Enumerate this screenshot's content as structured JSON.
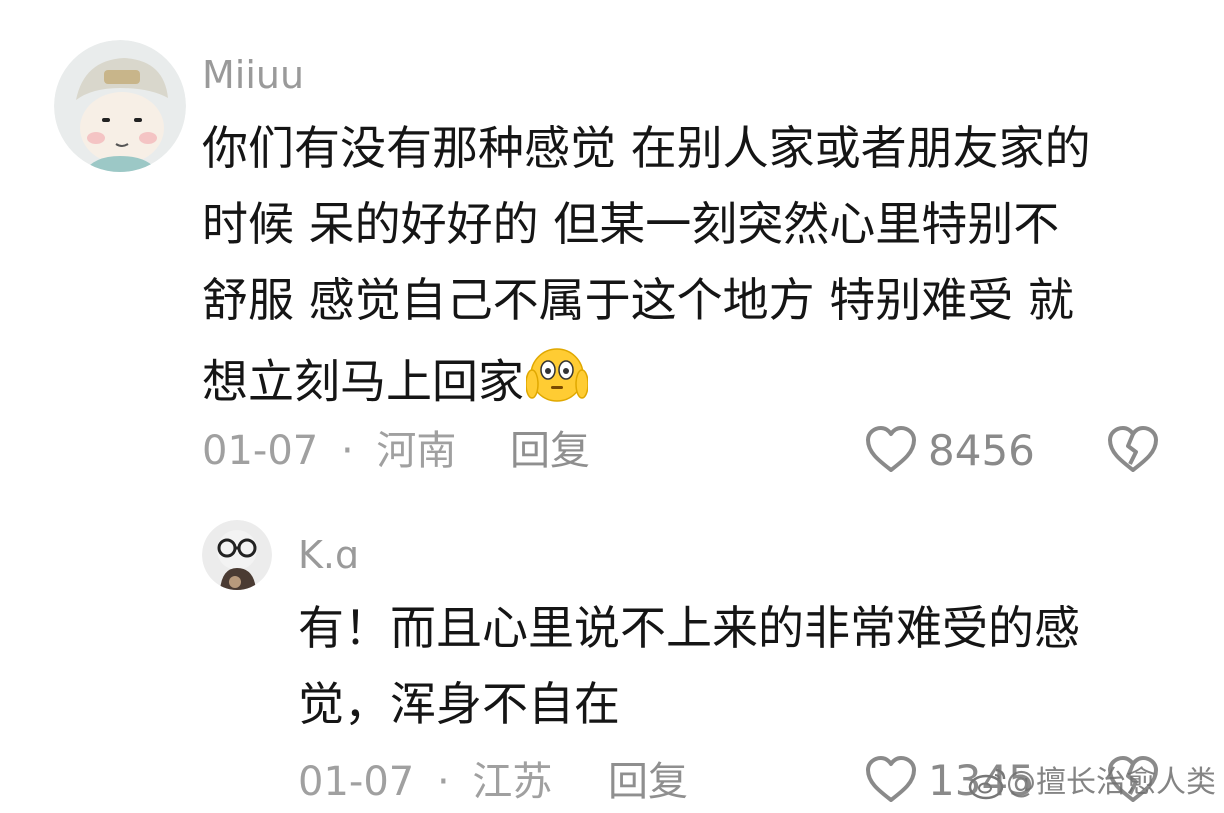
{
  "comments": [
    {
      "username": "Miiuu",
      "text_lines": [
        "你们有没有那种感觉 在别人家或者朋友家的",
        "时候 呆的好好的 但某一刻突然心里特别不",
        "舒服 感觉自己不属于这个地方 特别难受 就",
        "想立刻马上回家"
      ],
      "emoji": "flushed-face-with-hands-emoji",
      "date": "01-07",
      "separator": "·",
      "location": "河南",
      "reply_label": "回复",
      "like_count": "8456",
      "icons": {
        "like": "heart-outline-icon",
        "dislike": "broken-heart-icon"
      }
    },
    {
      "username": "K.ɑ",
      "text_lines": [
        "有！而且心里说不上来的非常难受的感",
        "觉，浑身不自在"
      ],
      "date": "01-07",
      "separator": "·",
      "location": "江苏",
      "reply_label": "回复",
      "like_count": "1345",
      "icons": {
        "like": "heart-outline-icon",
        "dislike": "broken-heart-icon"
      }
    }
  ],
  "watermark": {
    "text": "@擅长治愈人类",
    "icon": "weibo-logo-icon"
  },
  "colors": {
    "text": "#151515",
    "meta": "#a0a0a0",
    "icon": "#8a8a8a"
  }
}
